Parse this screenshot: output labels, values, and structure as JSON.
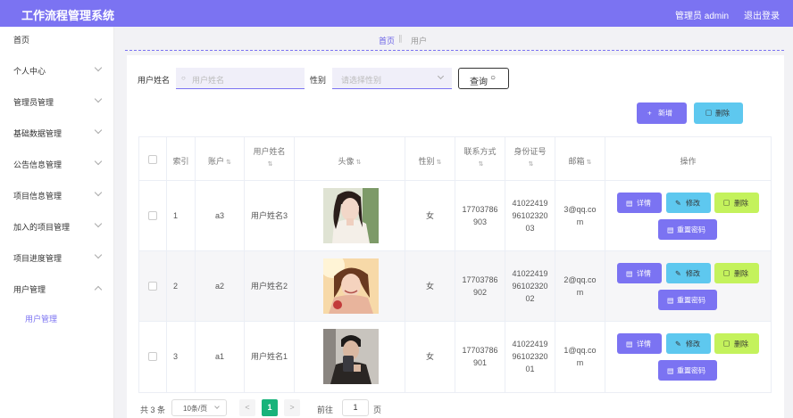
{
  "header": {
    "title": "工作流程管理系统",
    "admin": "管理员 admin",
    "logout": "退出登录"
  },
  "sidebar": {
    "items": [
      {
        "label": "首页",
        "chevron": false
      },
      {
        "label": "个人中心",
        "chevron": true
      },
      {
        "label": "管理员管理",
        "chevron": true
      },
      {
        "label": "基础数据管理",
        "chevron": true
      },
      {
        "label": "公告信息管理",
        "chevron": true
      },
      {
        "label": "项目信息管理",
        "chevron": true
      },
      {
        "label": "加入的项目管理",
        "chevron": true
      },
      {
        "label": "项目进度管理",
        "chevron": true
      },
      {
        "label": "用户管理",
        "chevron": true,
        "expanded": true
      }
    ],
    "subitem": "用户管理"
  },
  "breadcrumb": {
    "home": "首页",
    "current": "用户"
  },
  "search": {
    "name_label": "用户姓名",
    "name_placeholder": "用户姓名",
    "gender_label": "性别",
    "gender_placeholder": "请选择性别",
    "query_label": "查询"
  },
  "actions": {
    "add": "新增",
    "delete": "删除"
  },
  "table": {
    "headers": [
      "索引",
      "账户",
      "用户姓名",
      "头像",
      "性别",
      "联系方式",
      "身份证号",
      "邮箱",
      "操作"
    ],
    "rows": [
      {
        "index": "1",
        "account": "a3",
        "name": "用户姓名3",
        "gender": "女",
        "phone": [
          "17703786",
          "903"
        ],
        "idcard": [
          "41022419",
          "96102320",
          "03"
        ],
        "email": [
          "3@qq.co",
          "m"
        ]
      },
      {
        "index": "2",
        "account": "a2",
        "name": "用户姓名2",
        "gender": "女",
        "phone": [
          "17703786",
          "902"
        ],
        "idcard": [
          "41022419",
          "96102320",
          "02"
        ],
        "email": [
          "2@qq.co",
          "m"
        ]
      },
      {
        "index": "3",
        "account": "a1",
        "name": "用户姓名1",
        "gender": "女",
        "phone": [
          "17703786",
          "901"
        ],
        "idcard": [
          "41022419",
          "96102320",
          "01"
        ],
        "email": [
          "1@qq.co",
          "m"
        ]
      }
    ],
    "row_buttons": {
      "detail": "详情",
      "edit": "修改",
      "delete": "删除",
      "reset": "重置密码"
    }
  },
  "pagination": {
    "total": "共 3 条",
    "page_size": "10条/页",
    "current": "1",
    "goto": "前往",
    "goto_value": "1",
    "page": "页",
    "prev": "<",
    "next": ">"
  },
  "colors": {
    "primary": "#7b73f2",
    "info": "#5ec8ef",
    "success": "#c4f25c",
    "pager": "#18b37a"
  }
}
